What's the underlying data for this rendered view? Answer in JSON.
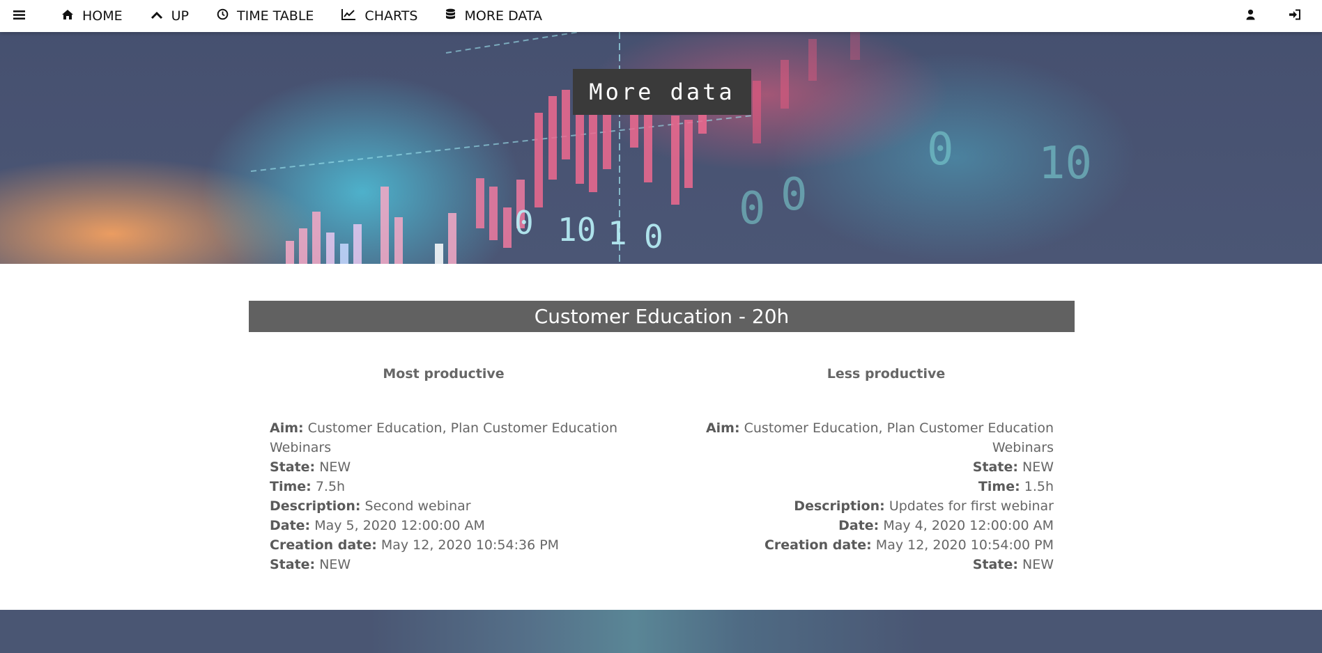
{
  "nav": {
    "home": "HOME",
    "up": "UP",
    "timetable": "TIME TABLE",
    "charts": "CHARTS",
    "more_data": "MORE DATA"
  },
  "hero": {
    "title": "More data",
    "background_digits": [
      "0",
      "10",
      "1",
      "0",
      "0",
      "0",
      "10",
      "0"
    ]
  },
  "section": {
    "title": "Customer Education - 20h"
  },
  "most_productive": {
    "heading": "Most productive",
    "fields": [
      {
        "label": "Aim:",
        "value": "Customer Education, Plan Customer Education Webinars"
      },
      {
        "label": "State:",
        "value": "NEW"
      },
      {
        "label": "Time:",
        "value": "7.5h"
      },
      {
        "label": "Description:",
        "value": "Second webinar"
      },
      {
        "label": "Date:",
        "value": "May 5, 2020 12:00:00 AM"
      },
      {
        "label": "Creation date:",
        "value": "May 12, 2020 10:54:36 PM"
      },
      {
        "label": "State:",
        "value": "NEW"
      }
    ]
  },
  "less_productive": {
    "heading": "Less productive",
    "fields": [
      {
        "label": "Aim:",
        "value": "Customer Education, Plan Customer Education Webinars"
      },
      {
        "label": "State:",
        "value": "NEW"
      },
      {
        "label": "Time:",
        "value": "1.5h"
      },
      {
        "label": "Description:",
        "value": "Updates for first webinar"
      },
      {
        "label": "Date:",
        "value": "May 4, 2020 12:00:00 AM"
      },
      {
        "label": "Creation date:",
        "value": "May 12, 2020 10:54:00 PM"
      },
      {
        "label": "State:",
        "value": "NEW"
      }
    ]
  },
  "colors": {
    "header_bar": "#616161",
    "hero_title_bg": "#3a3a3a",
    "hero_base": "#4b5675"
  },
  "icons": [
    "menu-icon",
    "home-icon",
    "chevron-up-icon",
    "clock-icon",
    "line-chart-icon",
    "database-icon",
    "user-icon",
    "sign-in-icon"
  ]
}
